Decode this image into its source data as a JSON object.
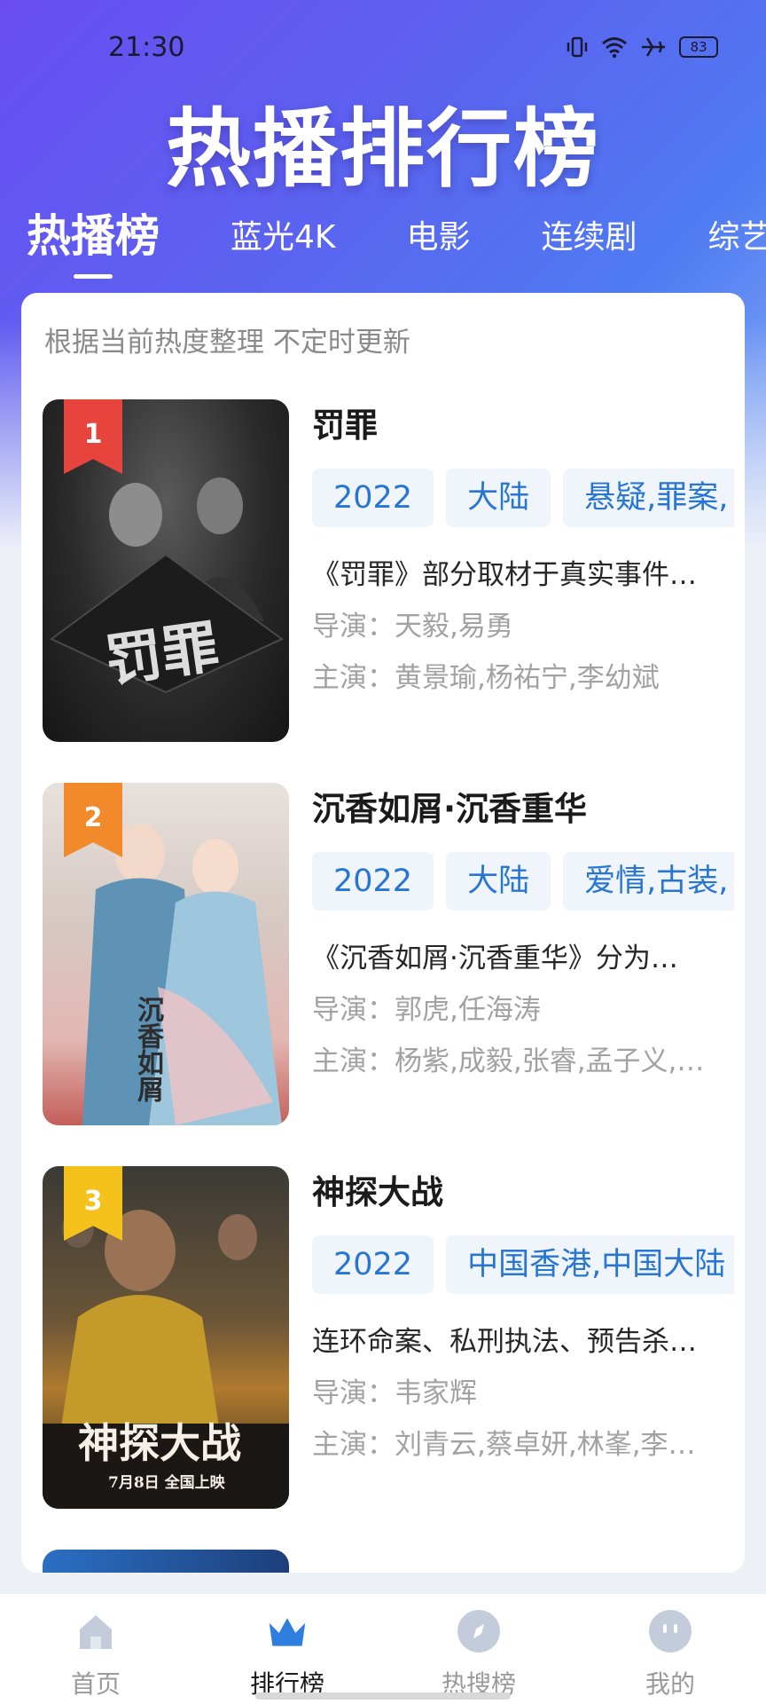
{
  "status": {
    "time": "21:30",
    "battery": "83"
  },
  "page_title": "热播排行榜",
  "tabs": [
    "热播榜",
    "蓝光4K",
    "电影",
    "连续剧",
    "综艺"
  ],
  "note": "根据当前热度整理 不定时更新",
  "items": [
    {
      "rank": "1",
      "rank_color": "#e8443e",
      "poster_text": "罚罪",
      "title": "罚罪",
      "tags": [
        "2022",
        "大陆",
        "悬疑,罪案,"
      ],
      "desc": "《罚罪》部分取材于真实事件…",
      "director": "导演：天毅,易勇",
      "cast": "主演：黄景瑜,杨祐宁,李幼斌"
    },
    {
      "rank": "2",
      "rank_color": "#f28a2c",
      "poster_text": "沉香如屑",
      "title": "沉香如屑·沉香重华",
      "tags": [
        "2022",
        "大陆",
        "爱情,古装,"
      ],
      "desc": "《沉香如屑·沉香重华》分为…",
      "director": "导演：郭虎,任海涛",
      "cast": "主演：杨紫,成毅,张睿,孟子义,…"
    },
    {
      "rank": "3",
      "rank_color": "#f5c21b",
      "poster_text": "神探大战",
      "poster_sub": "7月8日 全国上映",
      "title": "神探大战",
      "tags": [
        "2022",
        "中国香港,中国大陆"
      ],
      "desc": "连环命案、私刑执法、预告杀…",
      "director": "导演：韦家辉",
      "cast": "主演：刘青云,蔡卓妍,林峯,李…"
    }
  ],
  "nav": [
    {
      "label": "首页",
      "icon": "home-icon"
    },
    {
      "label": "排行榜",
      "icon": "crown-icon"
    },
    {
      "label": "热搜榜",
      "icon": "compass-icon"
    },
    {
      "label": "我的",
      "icon": "face-icon"
    }
  ],
  "colors": {
    "accent": "#2876d4",
    "hero_start": "#6a4df2",
    "hero_end": "#8ab0f6"
  }
}
